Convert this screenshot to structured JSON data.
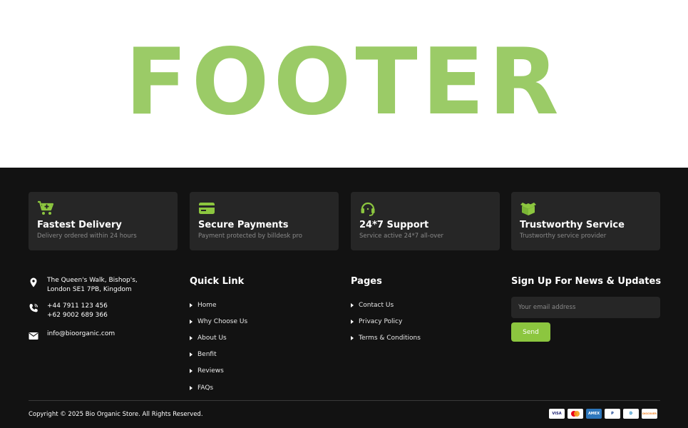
{
  "hero": {
    "title": "FOOTER"
  },
  "colors": {
    "accent": "#9bcb67",
    "button": "#8cc63f",
    "background": "#121212",
    "card": "#262626"
  },
  "features": [
    {
      "icon": "cart-plus-icon",
      "title": "Fastest Delivery",
      "desc": "Delivery ordered within 24 hours"
    },
    {
      "icon": "credit-card-icon",
      "title": "Secure Payments",
      "desc": "Payment protected by billdesk pro"
    },
    {
      "icon": "headset-icon",
      "title": "24*7 Support",
      "desc": "Service active 24*7 all-over"
    },
    {
      "icon": "box-icon",
      "title": "Trustworthy Service",
      "desc": "Trustworthy service provider"
    }
  ],
  "contact": {
    "address_line1": "The Queen's Walk, Bishop's,",
    "address_line2": "London SE1 7PB, Kingdom",
    "phone1": "+44 7911 123 456",
    "phone2": "+62 9002 689 366",
    "email": "info@bioorganic.com"
  },
  "quick_links": {
    "heading": "Quick Link",
    "items": [
      "Home",
      "Why Choose Us",
      "About Us",
      "Benfit",
      "Reviews",
      "FAQs"
    ]
  },
  "pages": {
    "heading": "Pages",
    "items": [
      "Contact Us",
      "Privacy Policy",
      "Terms & Conditions"
    ]
  },
  "newsletter": {
    "heading": "Sign Up For News & Updates",
    "placeholder": "Your email address",
    "button_label": "Send"
  },
  "bottom": {
    "copyright": "Copyright © 2025 Bio Organic Store. All Rights Reserved.",
    "payments": [
      {
        "name": "visa-icon",
        "label": "VISA"
      },
      {
        "name": "mastercard-icon",
        "label": ""
      },
      {
        "name": "amex-icon",
        "label": "AMEX"
      },
      {
        "name": "paypal-icon",
        "label": "P"
      },
      {
        "name": "diners-icon",
        "label": "D"
      },
      {
        "name": "discover-icon",
        "label": "DISCOVER"
      }
    ]
  }
}
